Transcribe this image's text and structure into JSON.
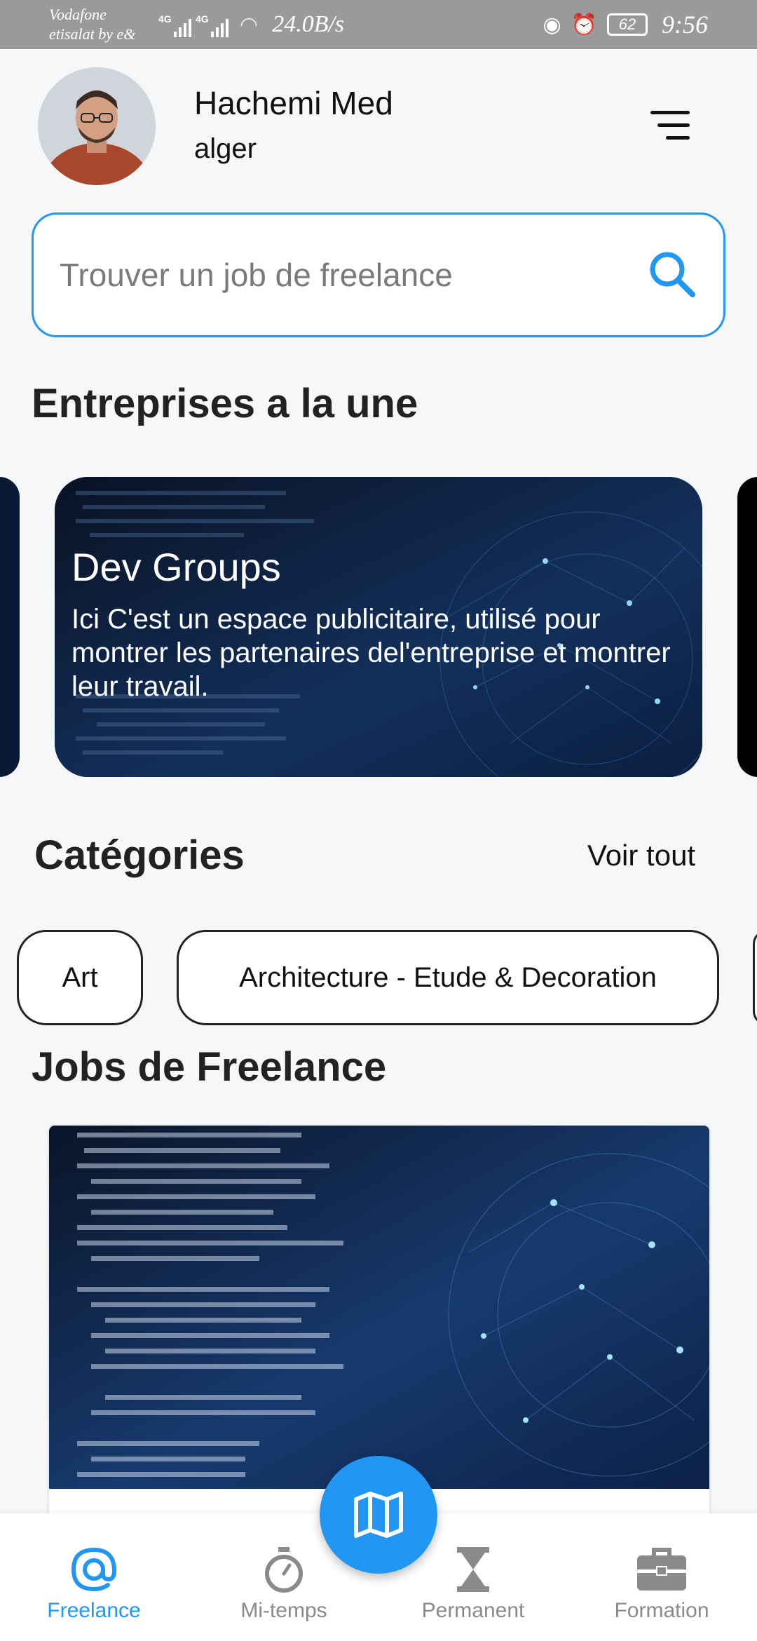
{
  "status_bar": {
    "carrier_line1": "Vodafone",
    "carrier_line2": "etisalat by e&",
    "network1": "4G",
    "network2": "4G",
    "speed": "24.0B/s",
    "battery": "62",
    "time": "9:56"
  },
  "header": {
    "user_name": "Hachemi Med",
    "user_city": "alger"
  },
  "search": {
    "placeholder": "Trouver un job de freelance"
  },
  "featured": {
    "section_title": "Entreprises a la une",
    "card_title": "Dev Groups",
    "card_description": "Ici C'est un espace publicitaire, utilisé pour montrer les partenaires del'entreprise et montrer leur travail."
  },
  "categories": {
    "section_title": "Catégories",
    "see_all": "Voir tout",
    "items": [
      "Art",
      "Architecture - Etude & Decoration"
    ]
  },
  "jobs": {
    "section_title": "Jobs de Freelance"
  },
  "bottom_nav": {
    "items": [
      {
        "label": "Freelance",
        "icon": "at-icon",
        "active": true
      },
      {
        "label": "Mi-temps",
        "icon": "stopwatch-icon",
        "active": false
      },
      {
        "label": "Permanent",
        "icon": "hourglass-icon",
        "active": false
      },
      {
        "label": "Formation",
        "icon": "briefcase-icon",
        "active": false
      }
    ],
    "fab_icon": "map-icon"
  },
  "colors": {
    "accent": "#2196f3",
    "text": "#111111",
    "muted": "#8a8a8a"
  }
}
